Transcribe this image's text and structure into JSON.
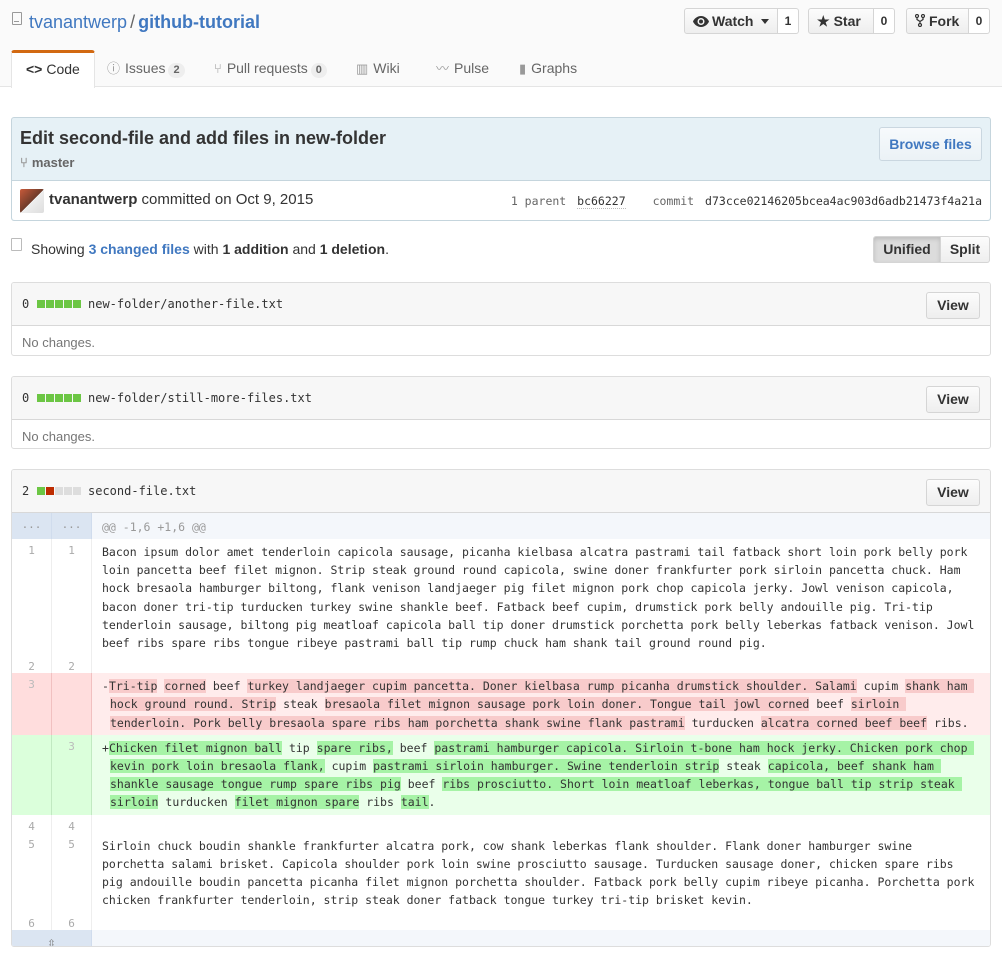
{
  "repo": {
    "owner": "tvanantwerp",
    "separator": "/",
    "name": "github-tutorial"
  },
  "actions": [
    {
      "label": "Watch",
      "icon": "eye-icon",
      "count": "1"
    },
    {
      "label": "Star",
      "icon": "star-icon",
      "count": "0"
    },
    {
      "label": "Fork",
      "icon": "fork-icon",
      "count": "0"
    }
  ],
  "tabs": [
    {
      "label": "Code",
      "icon": "code-icon"
    },
    {
      "label": "Issues",
      "count": "2",
      "icon": "issue-icon"
    },
    {
      "label": "Pull requests",
      "count": "0",
      "icon": "pull-request-icon"
    },
    {
      "label": "Wiki",
      "icon": "book-icon"
    },
    {
      "label": "Pulse",
      "icon": "pulse-icon"
    },
    {
      "label": "Graphs",
      "icon": "graph-icon"
    }
  ],
  "commit": {
    "title": "Edit second-file and add files in new-folder",
    "branch": "master",
    "browse_label": "Browse files",
    "author": "tvanantwerp",
    "committed_text": "committed on Oct 9, 2015",
    "parent_label": "1 parent",
    "parent_sha": "bc66227",
    "commit_label": "commit",
    "commit_sha": "d73cce02146205bcea4ac903d6adb21473f4a21a"
  },
  "toc": {
    "showing": "Showing",
    "changed_files": "3 changed files",
    "with": "with",
    "additions": "1 addition",
    "and": "and",
    "deletions": "1 deletion",
    "period": "."
  },
  "diff_view": {
    "unified": "Unified",
    "split": "Split"
  },
  "files": [
    {
      "changes": "0",
      "name": "new-folder/another-file.txt",
      "view_label": "View",
      "message": "No changes."
    },
    {
      "changes": "0",
      "name": "new-folder/still-more-files.txt",
      "view_label": "View",
      "message": "No changes."
    },
    {
      "changes": "2",
      "name": "second-file.txt",
      "view_label": "View",
      "hunk_nums": "...",
      "hunk": "@@ -1,6 +1,6 @@",
      "lines": [
        {
          "l": "1",
          "r": "1",
          "text": "Bacon ipsum dolor amet tenderloin capicola sausage, picanha kielbasa alcatra pastrami tail fatback short loin pork belly pork loin pancetta beef filet mignon. Strip steak ground round capicola, swine doner frankfurter pork sirloin pancetta chuck. Ham hock bresaola hamburger biltong, flank venison landjaeger pig filet mignon pork chop capicola jerky. Jowl venison capicola, bacon doner tri-tip turducken turkey swine shankle beef. Fatback beef cupim, drumstick pork belly andouille pig. Tri-tip tenderloin sausage, biltong pig meatloaf capicola ball tip doner drumstick porchetta pork belly leberkas fatback venison. Jowl beef ribs spare ribs tongue ribeye pastrami ball tip rump chuck ham shank tail ground round pig."
        },
        {
          "l": "2",
          "r": "2",
          "text": ""
        },
        {
          "l": "3",
          "r": "",
          "type": "del",
          "segments": [
            {
              "t": "Tri-tip",
              "hl": true
            },
            {
              "t": " "
            },
            {
              "t": "corned",
              "hl": true
            },
            {
              "t": " beef "
            },
            {
              "t": "turkey landjaeger cupim pancetta. Doner kielbasa rump picanha drumstick shoulder. Salami",
              "hl": true
            },
            {
              "t": " cupim "
            },
            {
              "t": "shank ham hock ground round. Strip",
              "hl": true
            },
            {
              "t": " steak "
            },
            {
              "t": "bresaola filet mignon sausage pork loin doner. Tongue tail jowl corned",
              "hl": true
            },
            {
              "t": " beef "
            },
            {
              "t": "sirloin tenderloin. Pork belly bresaola spare ribs ham porchetta shank swine flank pastrami",
              "hl": true
            },
            {
              "t": " turducken "
            },
            {
              "t": "alcatra corned beef beef",
              "hl": true
            },
            {
              "t": " ribs."
            }
          ]
        },
        {
          "l": "",
          "r": "3",
          "type": "add",
          "segments": [
            {
              "t": "Chicken filet mignon ball",
              "hl": true
            },
            {
              "t": " tip "
            },
            {
              "t": "spare ribs,",
              "hl": true
            },
            {
              "t": " beef "
            },
            {
              "t": "pastrami hamburger capicola. Sirloin t-bone ham hock jerky. Chicken pork chop kevin pork loin bresaola flank,",
              "hl": true
            },
            {
              "t": " cupim "
            },
            {
              "t": "pastrami sirloin hamburger. Swine tenderloin strip",
              "hl": true
            },
            {
              "t": " steak "
            },
            {
              "t": "capicola, beef shank ham shankle sausage tongue rump spare ribs pig",
              "hl": true
            },
            {
              "t": " beef "
            },
            {
              "t": "ribs prosciutto. Short loin meatloaf leberkas, tongue ball tip strip steak sirloin",
              "hl": true
            },
            {
              "t": " turducken "
            },
            {
              "t": "filet mignon spare",
              "hl": true
            },
            {
              "t": " ribs "
            },
            {
              "t": "tail",
              "hl": true
            },
            {
              "t": "."
            }
          ]
        },
        {
          "l": "4",
          "r": "4",
          "text": ""
        },
        {
          "l": "5",
          "r": "5",
          "text": "Sirloin chuck boudin shankle frankfurter alcatra pork, cow shank leberkas flank shoulder. Flank doner hamburger swine porchetta salami brisket. Capicola shoulder pork loin swine prosciutto sausage. Turducken sausage doner, chicken spare ribs pig andouille boudin pancetta picanha filet mignon porchetta shoulder. Fatback pork belly cupim ribeye picanha. Porchetta pork chicken frankfurter tenderloin, strip steak doner fatback tongue turkey tri-tip brisket kevin."
        },
        {
          "l": "6",
          "r": "6",
          "text": ""
        }
      ],
      "expand_icon": "expand-icon"
    }
  ]
}
